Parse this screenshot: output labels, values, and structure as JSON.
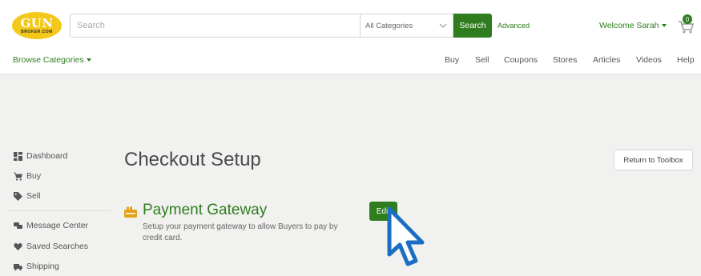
{
  "header": {
    "logo": {
      "main": "GUN",
      "sub": "BROKER.COM"
    },
    "search": {
      "placeholder": "Search",
      "value": ""
    },
    "category_select": {
      "selected": "All Categories"
    },
    "search_button": "Search",
    "advanced_link": "Advanced",
    "welcome": "Welcome Sarah",
    "cart_count": "0",
    "browse_categories": "Browse Categories",
    "nav": [
      "Buy",
      "Sell",
      "Coupons",
      "Stores",
      "Articles",
      "Videos",
      "Help"
    ]
  },
  "sidebar": {
    "items": [
      {
        "label": "Dashboard",
        "icon": "dashboard-icon"
      },
      {
        "label": "Buy",
        "icon": "cart-icon"
      },
      {
        "label": "Sell",
        "icon": "tag-icon"
      },
      {
        "label": "Message Center",
        "icon": "chat-icon"
      },
      {
        "label": "Saved Searches",
        "icon": "heart-icon"
      },
      {
        "label": "Shipping",
        "icon": "truck-icon"
      }
    ]
  },
  "main": {
    "title": "Checkout Setup",
    "return_button": "Return to Toolbox",
    "section": {
      "title": "Payment Gateway",
      "description": "Setup your payment gateway to allow Buyers to pay by credit card.",
      "edit_button": "Edit"
    }
  },
  "colors": {
    "brand_green": "#2f7d1f",
    "logo_yellow": "#f3c81b",
    "cursor_blue": "#1b6fc2"
  }
}
